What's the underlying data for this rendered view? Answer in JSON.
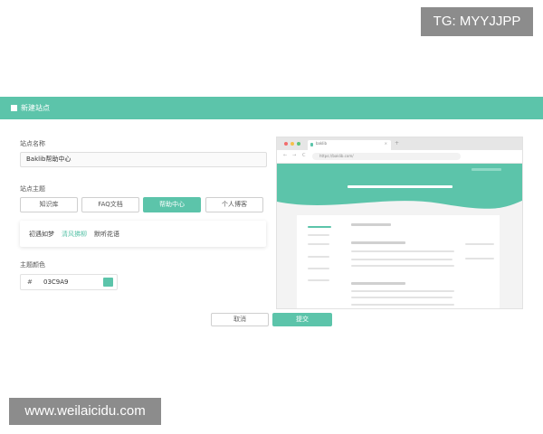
{
  "watermarks": {
    "top": "TG: MYYJJPP",
    "bottom": "www.weilaicidu.com"
  },
  "dialog": {
    "title": "新建站点",
    "site_name": {
      "label": "站点名称",
      "value": "Baklib帮助中心"
    },
    "site_theme": {
      "label": "站点主题",
      "tabs": [
        {
          "label": "知识库",
          "active": false
        },
        {
          "label": "FAQ文档",
          "active": false
        },
        {
          "label": "帮助中心",
          "active": true
        },
        {
          "label": "个人博客",
          "active": false
        }
      ],
      "styles": [
        {
          "label": "初遇如梦",
          "selected": false
        },
        {
          "label": "清风拂柳",
          "selected": true
        },
        {
          "label": "默听花语",
          "selected": false
        }
      ]
    },
    "theme_color": {
      "label": "主题颜色",
      "hash": "#",
      "value": "03C9A9"
    },
    "buttons": {
      "cancel": "取消",
      "submit": "提交"
    },
    "preview": {
      "tab_title": "baklib",
      "tab_close": "×",
      "new_tab": "+",
      "nav_back": "←",
      "nav_forward": "→",
      "nav_reload": "C",
      "url": "https://baklib.com/"
    }
  },
  "colors": {
    "accent": "#5cc4aa",
    "watermark_bg": "#8c8c8c",
    "dot_red": "#f26c6c",
    "dot_yellow": "#f5c04a",
    "dot_green": "#5cc47a"
  }
}
